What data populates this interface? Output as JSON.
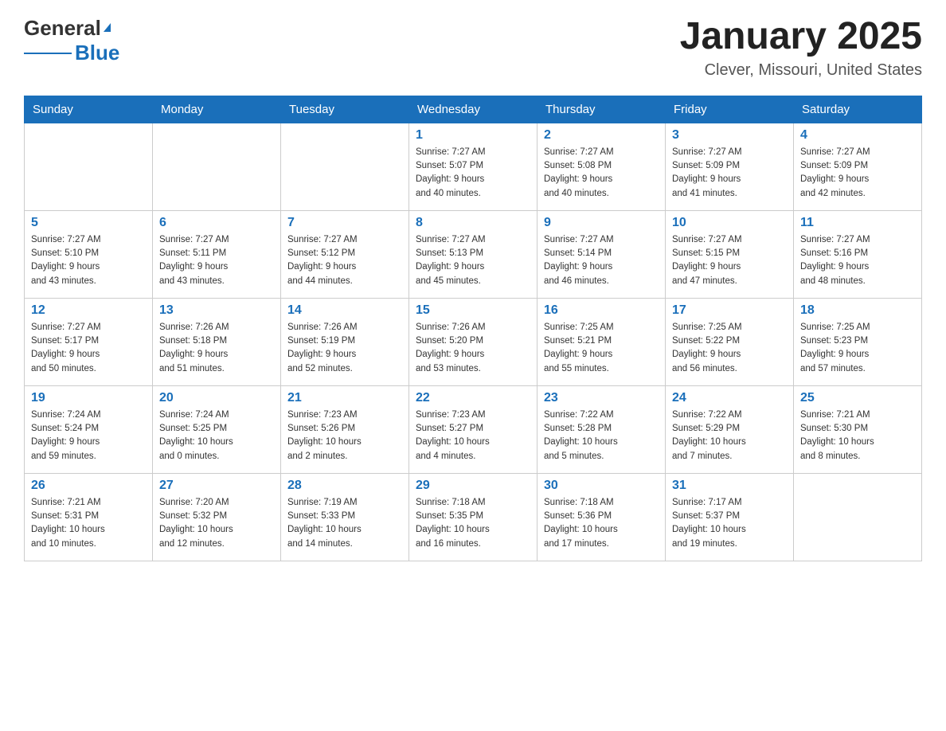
{
  "header": {
    "logo_general": "General",
    "logo_blue": "Blue",
    "month_title": "January 2025",
    "location": "Clever, Missouri, United States"
  },
  "weekdays": [
    "Sunday",
    "Monday",
    "Tuesday",
    "Wednesday",
    "Thursday",
    "Friday",
    "Saturday"
  ],
  "weeks": [
    [
      {
        "day": "",
        "info": ""
      },
      {
        "day": "",
        "info": ""
      },
      {
        "day": "",
        "info": ""
      },
      {
        "day": "1",
        "info": "Sunrise: 7:27 AM\nSunset: 5:07 PM\nDaylight: 9 hours\nand 40 minutes."
      },
      {
        "day": "2",
        "info": "Sunrise: 7:27 AM\nSunset: 5:08 PM\nDaylight: 9 hours\nand 40 minutes."
      },
      {
        "day": "3",
        "info": "Sunrise: 7:27 AM\nSunset: 5:09 PM\nDaylight: 9 hours\nand 41 minutes."
      },
      {
        "day": "4",
        "info": "Sunrise: 7:27 AM\nSunset: 5:09 PM\nDaylight: 9 hours\nand 42 minutes."
      }
    ],
    [
      {
        "day": "5",
        "info": "Sunrise: 7:27 AM\nSunset: 5:10 PM\nDaylight: 9 hours\nand 43 minutes."
      },
      {
        "day": "6",
        "info": "Sunrise: 7:27 AM\nSunset: 5:11 PM\nDaylight: 9 hours\nand 43 minutes."
      },
      {
        "day": "7",
        "info": "Sunrise: 7:27 AM\nSunset: 5:12 PM\nDaylight: 9 hours\nand 44 minutes."
      },
      {
        "day": "8",
        "info": "Sunrise: 7:27 AM\nSunset: 5:13 PM\nDaylight: 9 hours\nand 45 minutes."
      },
      {
        "day": "9",
        "info": "Sunrise: 7:27 AM\nSunset: 5:14 PM\nDaylight: 9 hours\nand 46 minutes."
      },
      {
        "day": "10",
        "info": "Sunrise: 7:27 AM\nSunset: 5:15 PM\nDaylight: 9 hours\nand 47 minutes."
      },
      {
        "day": "11",
        "info": "Sunrise: 7:27 AM\nSunset: 5:16 PM\nDaylight: 9 hours\nand 48 minutes."
      }
    ],
    [
      {
        "day": "12",
        "info": "Sunrise: 7:27 AM\nSunset: 5:17 PM\nDaylight: 9 hours\nand 50 minutes."
      },
      {
        "day": "13",
        "info": "Sunrise: 7:26 AM\nSunset: 5:18 PM\nDaylight: 9 hours\nand 51 minutes."
      },
      {
        "day": "14",
        "info": "Sunrise: 7:26 AM\nSunset: 5:19 PM\nDaylight: 9 hours\nand 52 minutes."
      },
      {
        "day": "15",
        "info": "Sunrise: 7:26 AM\nSunset: 5:20 PM\nDaylight: 9 hours\nand 53 minutes."
      },
      {
        "day": "16",
        "info": "Sunrise: 7:25 AM\nSunset: 5:21 PM\nDaylight: 9 hours\nand 55 minutes."
      },
      {
        "day": "17",
        "info": "Sunrise: 7:25 AM\nSunset: 5:22 PM\nDaylight: 9 hours\nand 56 minutes."
      },
      {
        "day": "18",
        "info": "Sunrise: 7:25 AM\nSunset: 5:23 PM\nDaylight: 9 hours\nand 57 minutes."
      }
    ],
    [
      {
        "day": "19",
        "info": "Sunrise: 7:24 AM\nSunset: 5:24 PM\nDaylight: 9 hours\nand 59 minutes."
      },
      {
        "day": "20",
        "info": "Sunrise: 7:24 AM\nSunset: 5:25 PM\nDaylight: 10 hours\nand 0 minutes."
      },
      {
        "day": "21",
        "info": "Sunrise: 7:23 AM\nSunset: 5:26 PM\nDaylight: 10 hours\nand 2 minutes."
      },
      {
        "day": "22",
        "info": "Sunrise: 7:23 AM\nSunset: 5:27 PM\nDaylight: 10 hours\nand 4 minutes."
      },
      {
        "day": "23",
        "info": "Sunrise: 7:22 AM\nSunset: 5:28 PM\nDaylight: 10 hours\nand 5 minutes."
      },
      {
        "day": "24",
        "info": "Sunrise: 7:22 AM\nSunset: 5:29 PM\nDaylight: 10 hours\nand 7 minutes."
      },
      {
        "day": "25",
        "info": "Sunrise: 7:21 AM\nSunset: 5:30 PM\nDaylight: 10 hours\nand 8 minutes."
      }
    ],
    [
      {
        "day": "26",
        "info": "Sunrise: 7:21 AM\nSunset: 5:31 PM\nDaylight: 10 hours\nand 10 minutes."
      },
      {
        "day": "27",
        "info": "Sunrise: 7:20 AM\nSunset: 5:32 PM\nDaylight: 10 hours\nand 12 minutes."
      },
      {
        "day": "28",
        "info": "Sunrise: 7:19 AM\nSunset: 5:33 PM\nDaylight: 10 hours\nand 14 minutes."
      },
      {
        "day": "29",
        "info": "Sunrise: 7:18 AM\nSunset: 5:35 PM\nDaylight: 10 hours\nand 16 minutes."
      },
      {
        "day": "30",
        "info": "Sunrise: 7:18 AM\nSunset: 5:36 PM\nDaylight: 10 hours\nand 17 minutes."
      },
      {
        "day": "31",
        "info": "Sunrise: 7:17 AM\nSunset: 5:37 PM\nDaylight: 10 hours\nand 19 minutes."
      },
      {
        "day": "",
        "info": ""
      }
    ]
  ]
}
